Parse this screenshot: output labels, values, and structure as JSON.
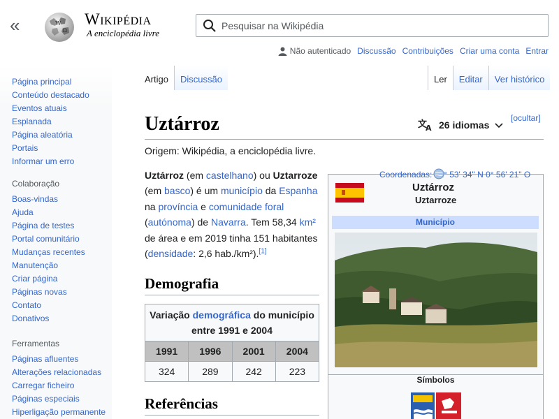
{
  "header": {
    "logo_word": "Wikipédia",
    "logo_tagline": "A enciclopédia livre",
    "search_placeholder": "Pesquisar na Wikipédia"
  },
  "personal": {
    "not_logged": "Não autenticado",
    "links": [
      "Discussão",
      "Contribuições",
      "Criar uma conta",
      "Entrar"
    ]
  },
  "sidebar": {
    "main": [
      "Página principal",
      "Conteúdo destacado",
      "Eventos atuais",
      "Esplanada",
      "Página aleatória",
      "Portais",
      "Informar um erro"
    ],
    "collab_title": "Colaboração",
    "collab": [
      "Boas-vindas",
      "Ajuda",
      "Página de testes",
      "Portal comunitário",
      "Mudanças recentes",
      "Manutenção",
      "Criar página",
      "Páginas novas",
      "Contato",
      "Donativos"
    ],
    "tools_title": "Ferramentas",
    "tools": [
      "Páginas afluentes",
      "Alterações relacionadas",
      "Carregar ficheiro",
      "Páginas especiais",
      "Hiperligação permanente"
    ]
  },
  "tabs": {
    "left": [
      "Artigo",
      "Discussão"
    ],
    "right": [
      "Ler",
      "Editar",
      "Ver histórico"
    ]
  },
  "article": {
    "title": "Uztárroz",
    "languages": "26 idiomas",
    "hide": "[ocultar]",
    "from": "Origem: Wikipédia, a enciclopédia livre.",
    "intro": {
      "name1": "Uztárroz",
      "t1": " (em ",
      "l1": "castelhano",
      "t2": ") ou ",
      "name2": "Uztarroze",
      "t3": " (em ",
      "l2": "basco",
      "t4": ") é um ",
      "l3": "município",
      "t5": " da ",
      "l4": "Espanha",
      "t6": " na ",
      "l5": "província",
      "t7": " e ",
      "l6": "comunidade foral",
      "t8": " (",
      "l7": "autónoma",
      "t9": ") de ",
      "l8": "Navarra",
      "t10": ". Tem 58,34 ",
      "l9": "km²",
      "t11": " de área e em 2019 tinha 151 habitantes (",
      "l10": "densidade",
      "t12": ": 2,6 hab./km²).",
      "ref": "[1]"
    },
    "h_demography": "Demografia",
    "h_refs": "Referências",
    "demo_table": {
      "caption_a": "Variação ",
      "caption_link": "demográfica",
      "caption_b": " do município entre 1991 e 2004",
      "years": [
        "1991",
        "1996",
        "2001",
        "2004"
      ],
      "values": [
        "324",
        "289",
        "242",
        "223"
      ]
    }
  },
  "infobox": {
    "coords": "Coordenadas: 42° 53' 34\" N 0° 56' 21\" O",
    "name": "Uztárroz",
    "subname": "Uztarroze",
    "type": "Município",
    "symbols": "Símbolos"
  },
  "colors": {
    "link": "#3366cc",
    "border": "#a2a9b1",
    "infobox_header": "#ccddff",
    "table_header": "#c0c0c0"
  }
}
